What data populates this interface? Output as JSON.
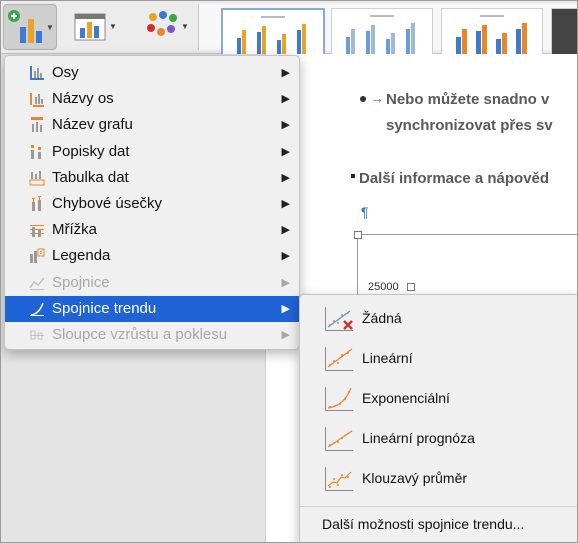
{
  "document": {
    "line1": "Nebo můžete snadno v",
    "line2": "synchronizovat přes sv",
    "heading": "Další informace a nápověd",
    "pilcrow": "¶",
    "axis_label": "25000"
  },
  "chart_menu": {
    "items": [
      {
        "label": "Osy",
        "icon": "axes-icon",
        "disabled": false,
        "highlighted": false
      },
      {
        "label": "Názvy os",
        "icon": "axis-titles-icon",
        "disabled": false,
        "highlighted": false
      },
      {
        "label": "Název grafu",
        "icon": "chart-title-icon",
        "disabled": false,
        "highlighted": false
      },
      {
        "label": "Popisky dat",
        "icon": "data-labels-icon",
        "disabled": false,
        "highlighted": false
      },
      {
        "label": "Tabulka dat",
        "icon": "data-table-icon",
        "disabled": false,
        "highlighted": false
      },
      {
        "label": "Chybové úsečky",
        "icon": "error-bars-icon",
        "disabled": false,
        "highlighted": false
      },
      {
        "label": "Mřížka",
        "icon": "gridlines-icon",
        "disabled": false,
        "highlighted": false
      },
      {
        "label": "Legenda",
        "icon": "legend-icon",
        "disabled": false,
        "highlighted": false
      },
      {
        "label": "Spojnice",
        "icon": "lines-icon",
        "disabled": true,
        "highlighted": false
      },
      {
        "label": "Spojnice trendu",
        "icon": "trendline-icon",
        "disabled": false,
        "highlighted": true
      },
      {
        "label": "Sloupce vzrůstu a poklesu",
        "icon": "up-down-bars-icon",
        "disabled": true,
        "highlighted": false
      }
    ],
    "submenu_arrow": "▶"
  },
  "trendline_submenu": {
    "items": [
      {
        "label": "Žádná",
        "icon": "trendline-none-icon"
      },
      {
        "label": "Lineární",
        "icon": "trendline-linear-icon"
      },
      {
        "label": "Exponenciální",
        "icon": "trendline-exponential-icon"
      },
      {
        "label": "Lineární prognóza",
        "icon": "trendline-linear-forecast-icon"
      },
      {
        "label": "Klouzavý průměr",
        "icon": "trendline-moving-average-icon"
      }
    ],
    "more_options": "Další možnosti spojnice trendu..."
  },
  "colors": {
    "highlight": "#1f63d6",
    "icon_orange": "#e8862c",
    "icon_blue": "#3e7bd0",
    "delete_red": "#d23030",
    "doc_text": "#595959",
    "link_blue": "#2f6fd0"
  }
}
